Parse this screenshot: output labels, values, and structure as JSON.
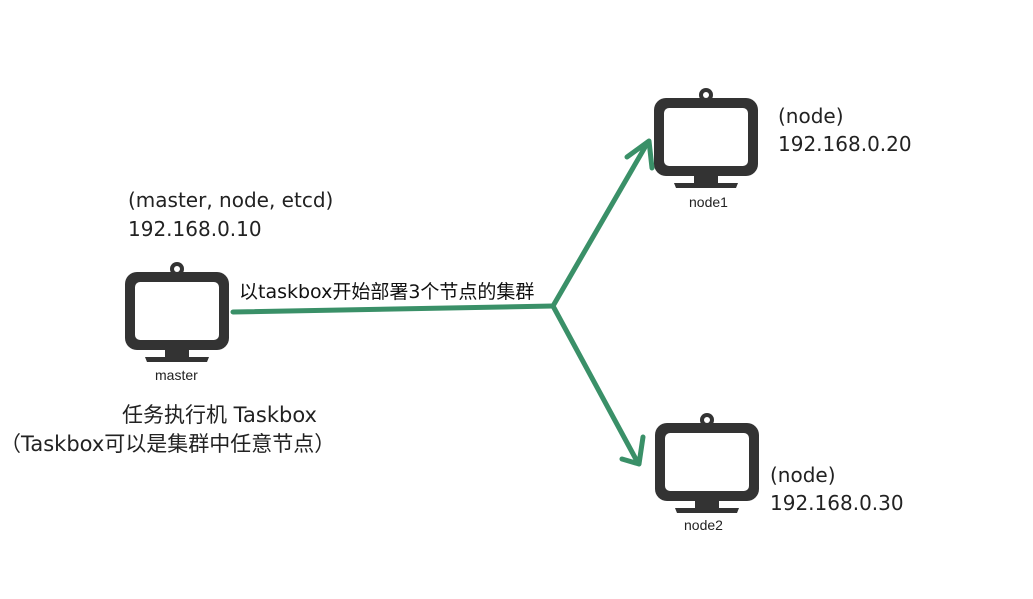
{
  "colors": {
    "edge": "#3a9068",
    "monitor": "#333333",
    "screen": "#ffffff",
    "background": "#ffffff",
    "text": "#222222"
  },
  "master": {
    "roles": "(master, node, etcd)",
    "ip": "192.168.0.10",
    "host_label": "master",
    "icon": "monitor-icon"
  },
  "node1": {
    "roles": "(node)",
    "ip": "192.168.0.20",
    "host_label": "node1",
    "icon": "monitor-icon"
  },
  "node2": {
    "roles": "(node)",
    "ip": "192.168.0.30",
    "host_label": "node2",
    "icon": "monitor-icon"
  },
  "edge_label": "以taskbox开始部署3个节点的集群",
  "caption": {
    "line1": "任务执行机 Taskbox",
    "line2": "（Taskbox可以是集群中任意节点）"
  }
}
